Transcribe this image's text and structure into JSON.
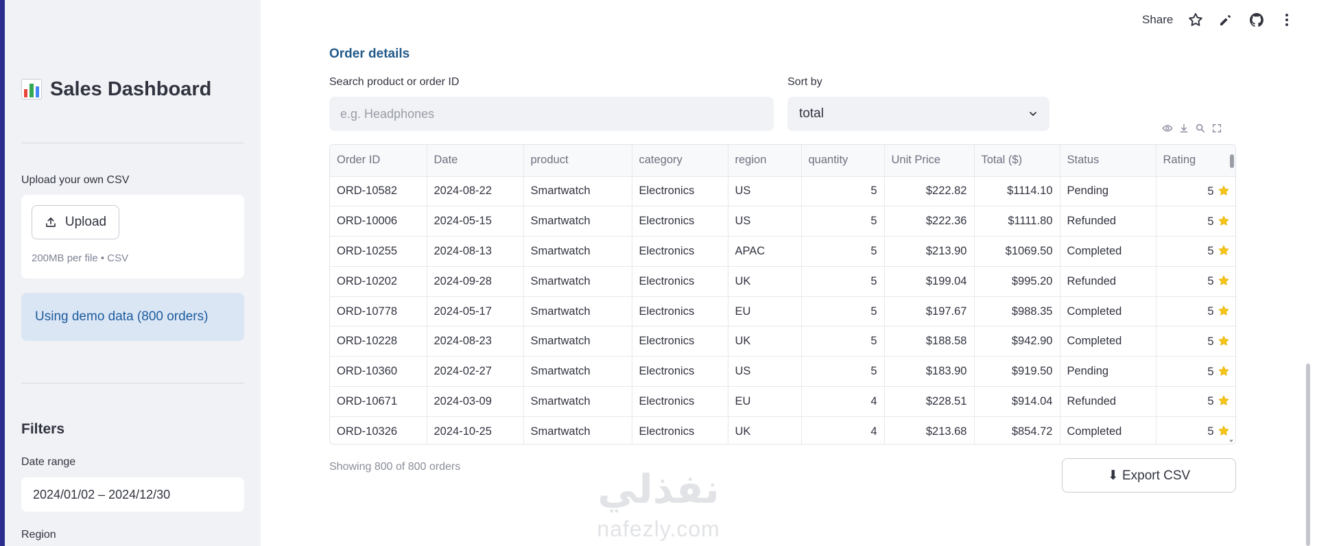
{
  "sidebar": {
    "title": "Sales Dashboard",
    "upload_label": "Upload your own CSV",
    "upload_button": "Upload",
    "upload_hint": "200MB per file • CSV",
    "info": "Using demo data (800 orders)",
    "filters_heading": "Filters",
    "date_range_label": "Date range",
    "date_range_value": "2024/01/02 – 2024/12/30",
    "region_label": "Region"
  },
  "topbar": {
    "share_label": "Share"
  },
  "main": {
    "section_title": "Order details",
    "search_label": "Search product or order ID",
    "search_placeholder": "e.g. Headphones",
    "sort_label": "Sort by",
    "sort_value": "total",
    "showing": "Showing 800 of 800 orders",
    "export_label": "⬇ Export CSV"
  },
  "table": {
    "columns": [
      "Order ID",
      "Date",
      "product",
      "category",
      "region",
      "quantity",
      "Unit Price",
      "Total ($)",
      "Status",
      "Rating"
    ],
    "rows": [
      [
        "ORD-10582",
        "2024-08-22",
        "Smartwatch",
        "Electronics",
        "US",
        "5",
        "$222.82",
        "$1114.10",
        "Pending",
        "5"
      ],
      [
        "ORD-10006",
        "2024-05-15",
        "Smartwatch",
        "Electronics",
        "US",
        "5",
        "$222.36",
        "$1111.80",
        "Refunded",
        "5"
      ],
      [
        "ORD-10255",
        "2024-08-13",
        "Smartwatch",
        "Electronics",
        "APAC",
        "5",
        "$213.90",
        "$1069.50",
        "Completed",
        "5"
      ],
      [
        "ORD-10202",
        "2024-09-28",
        "Smartwatch",
        "Electronics",
        "UK",
        "5",
        "$199.04",
        "$995.20",
        "Refunded",
        "5"
      ],
      [
        "ORD-10778",
        "2024-05-17",
        "Smartwatch",
        "Electronics",
        "EU",
        "5",
        "$197.67",
        "$988.35",
        "Completed",
        "5"
      ],
      [
        "ORD-10228",
        "2024-08-23",
        "Smartwatch",
        "Electronics",
        "UK",
        "5",
        "$188.58",
        "$942.90",
        "Completed",
        "5"
      ],
      [
        "ORD-10360",
        "2024-02-27",
        "Smartwatch",
        "Electronics",
        "US",
        "5",
        "$183.90",
        "$919.50",
        "Pending",
        "5"
      ],
      [
        "ORD-10671",
        "2024-03-09",
        "Smartwatch",
        "Electronics",
        "EU",
        "4",
        "$228.51",
        "$914.04",
        "Refunded",
        "5"
      ],
      [
        "ORD-10326",
        "2024-10-25",
        "Smartwatch",
        "Electronics",
        "UK",
        "4",
        "$213.68",
        "$854.72",
        "Completed",
        "5"
      ]
    ]
  },
  "watermark": {
    "arabic": "نفذلي",
    "latin": "nafezly.com"
  },
  "icons": {
    "title_icon": "bar-chart-icon",
    "upload_icon": "upload-icon",
    "rating_icon": "star-icon"
  },
  "colors": {
    "accent": "#235a8a",
    "info_bg": "#dbe6f5",
    "info_text": "#1c5b9c",
    "sidebar_bg": "#f0f2f6",
    "star": "#f5c518"
  }
}
